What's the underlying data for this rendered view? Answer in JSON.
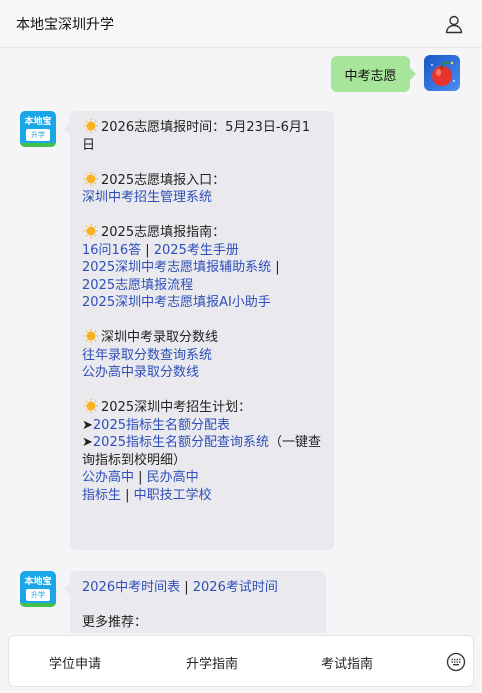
{
  "header": {
    "title": "本地宝深圳升学"
  },
  "user_message": "中考志愿",
  "bot_avatar": {
    "top_text": "本地宝",
    "bottom_text": "升学"
  },
  "message1": {
    "s1_title": "2026志愿填报时间：5月23日-6月1日",
    "s2_title": "2025志愿填报入口：",
    "s2_link1": "深圳中考招生管理系统",
    "s3_title": "2025志愿填报指南：",
    "s3_l1a": "16问16答",
    "s3_sep1": " | ",
    "s3_l1b": "2025考生手册",
    "s3_l2": "2025深圳中考志愿填报辅助系统",
    "s3_sep2": " | ",
    "s3_l3": "2025志愿填报流程",
    "s3_l4": "2025深圳中考志愿填报AI小助手",
    "s4_title": "深圳中考录取分数线",
    "s4_l1": "往年录取分数查询系统",
    "s4_l2": "公办高中录取分数线",
    "s5_title": "2025深圳中考招生计划：",
    "arrow": "➤",
    "s5_l1": "2025指标生名额分配表",
    "s5_l2": "2025指标生名额分配查询系统",
    "s5_l2_note": "（一键查询指标到校明细）",
    "s5_l3a": "公办高中",
    "s5_sep3": " | ",
    "s5_l3b": "民办高中",
    "s5_l4a": "指标生",
    "s5_sep4": " | ",
    "s5_l4b": "中职技工学校"
  },
  "message2": {
    "l1a": "2026中考时间表",
    "sep": " | ",
    "l1b": "2026考试时间",
    "more": "更多推荐："
  },
  "tabbar": {
    "tab1": "学位申请",
    "tab2": "升学指南",
    "tab3": "考试指南"
  }
}
